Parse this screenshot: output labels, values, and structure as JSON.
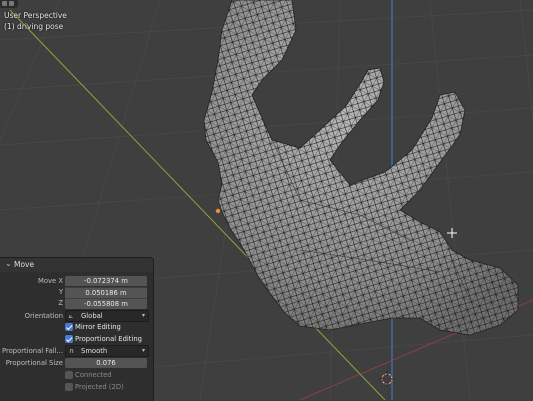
{
  "viewport": {
    "view_name": "User Perspective",
    "object_info": "(1) driving pose"
  },
  "colors": {
    "background": "#3f3f3f",
    "mesh_fill": "#9a9a9a",
    "wire": "#111111",
    "y_axis": "#8aa83a",
    "z_axis": "#3f7fd4",
    "x_axis": "#c0404a",
    "selection": "#f08a3c",
    "checkbox_on": "#4a7bd0"
  },
  "panel": {
    "title": "Move",
    "move_x_label": "Move X",
    "move_x": "-0.072374 m",
    "y_label": "Y",
    "y": "0.050186 m",
    "z_label": "Z",
    "z": "-0.055808 m",
    "orientation_label": "Orientation",
    "orientation_value": "Global",
    "orientation_icon": "orientation-global-icon",
    "mirror_editing": "Mirror Editing",
    "proportional_editing": "Proportional Editing",
    "falloff_label": "Proportional Fall...",
    "falloff_value": "Smooth",
    "falloff_icon": "smooth-falloff-icon",
    "size_label": "Proportional Size",
    "size_value": "0.076",
    "connected": "Connected",
    "projected": "Projected (2D)"
  }
}
